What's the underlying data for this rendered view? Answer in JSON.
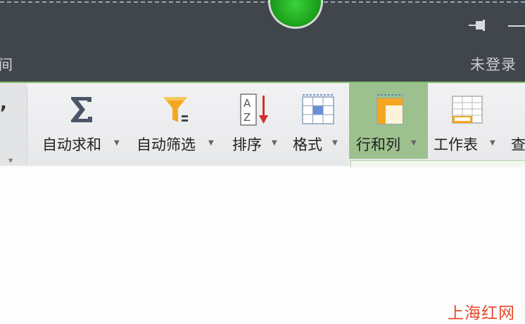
{
  "titlebar": {
    "menu_fragment": "间",
    "login_status": "未登录"
  },
  "ribbon": {
    "left_fragment_glyph": ",",
    "tools": {
      "autosum": {
        "label": "自动求和",
        "icon": "sigma-icon"
      },
      "autofilter": {
        "label": "自动筛选",
        "icon": "funnel-filter-icon"
      },
      "sort": {
        "label": "排序",
        "icon": "sort-az-icon"
      },
      "format": {
        "label": "格式",
        "icon": "cell-format-icon"
      },
      "rowcol": {
        "label": "行和列",
        "icon": "rows-columns-icon"
      },
      "worksheet": {
        "label": "工作表",
        "icon": "worksheet-icon"
      },
      "find": {
        "label": "查",
        "icon": null
      }
    },
    "caret": "▼"
  },
  "watermark": "上海红网",
  "colors": {
    "titlebar_bg": "#41454c",
    "active_tool_bg": "#9cc18f",
    "watermark": "#e84a2c",
    "filter_funnel": "#f5a623",
    "sort_arrow": "#d32f2f"
  }
}
